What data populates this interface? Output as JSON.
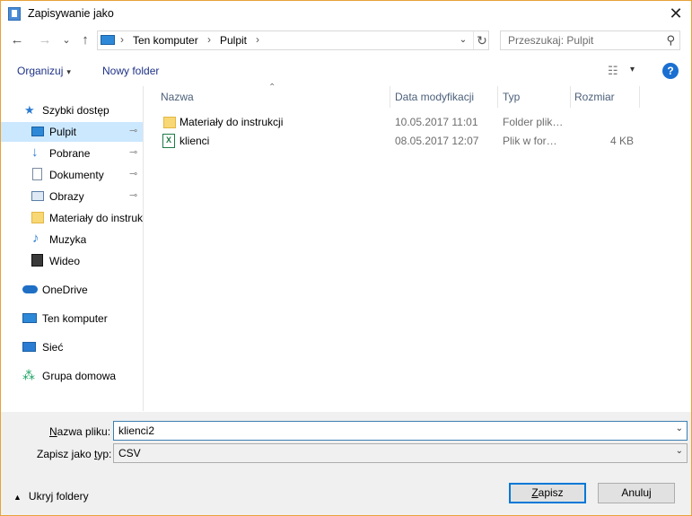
{
  "window": {
    "title": "Zapisywanie jako",
    "close_glyph": "✕"
  },
  "nav": {
    "back_glyph": "←",
    "forward_glyph": "→",
    "recent_glyph": "⌄",
    "up_glyph": "↑"
  },
  "address": {
    "crumbs": [
      "Ten komputer",
      "Pulpit"
    ],
    "separator": "›",
    "dropdown_glyph": "⌄",
    "refresh_glyph": "↻"
  },
  "search": {
    "placeholder": "Przeszukaj: Pulpit",
    "icon_glyph": "⚲"
  },
  "toolbar": {
    "organize": "Organizuj",
    "new_folder": "Nowy folder",
    "caret": "▾",
    "view_glyph": "☷",
    "help_glyph": "?"
  },
  "sidebar": {
    "pin_glyph": "📌",
    "items": [
      {
        "label": "Szybki dostęp",
        "icon": "star-icon",
        "color": "#2b7cd3"
      },
      {
        "label": "Pulpit",
        "icon": "desktop-icon",
        "color": "#2d89d7",
        "pinned": true,
        "selected": true
      },
      {
        "label": "Pobrane",
        "icon": "download-icon",
        "color": "#2b7cd3",
        "pinned": true
      },
      {
        "label": "Dokumenty",
        "icon": "documents-icon",
        "color": "#7a8aa0",
        "pinned": true
      },
      {
        "label": "Obrazy",
        "icon": "pictures-icon",
        "color": "#5b7fa6",
        "pinned": true
      },
      {
        "label": "Materiały do instrukcji",
        "icon": "folder-icon",
        "color": "#f8d775"
      },
      {
        "label": "Muzyka",
        "icon": "music-icon",
        "color": "#2b7cd3"
      },
      {
        "label": "Wideo",
        "icon": "video-icon",
        "color": "#3a3a3a"
      },
      {
        "label": "OneDrive",
        "icon": "onedrive-icon",
        "color": "#1f6fc5"
      },
      {
        "label": "Ten komputer",
        "icon": "computer-icon",
        "color": "#2d89d7"
      },
      {
        "label": "Sieć",
        "icon": "network-icon",
        "color": "#2b7cd3"
      },
      {
        "label": "Grupa domowa",
        "icon": "homegroup-icon",
        "color": "#1aa260"
      }
    ]
  },
  "file_list": {
    "columns": [
      "Nazwa",
      "Data modyfikacji",
      "Typ",
      "Rozmiar"
    ],
    "sort_glyph": "⌃",
    "rows": [
      {
        "name": "Materiały do instrukcji",
        "date": "10.05.2017 11:01",
        "type": "Folder plik…",
        "size": "",
        "icon": "folder-icon"
      },
      {
        "name": "klienci",
        "date": "08.05.2017 12:07",
        "type": "Plik w for…",
        "size": "4 KB",
        "icon": "excel-file-icon"
      }
    ]
  },
  "form": {
    "filename_label_u": "N",
    "filename_label_rest": "azwa pliku:",
    "filename_value": "klienci2",
    "filetype_label_pre": "Zapisz jako ",
    "filetype_label_u": "t",
    "filetype_label_rest": "yp:",
    "filetype_value": "CSV",
    "dropdown_glyph": "⌄"
  },
  "footer": {
    "hide_folders_caret": "▲",
    "hide_folders": "Ukryj foldery",
    "save_u": "Z",
    "save_rest": "apisz",
    "cancel": "Anuluj"
  }
}
